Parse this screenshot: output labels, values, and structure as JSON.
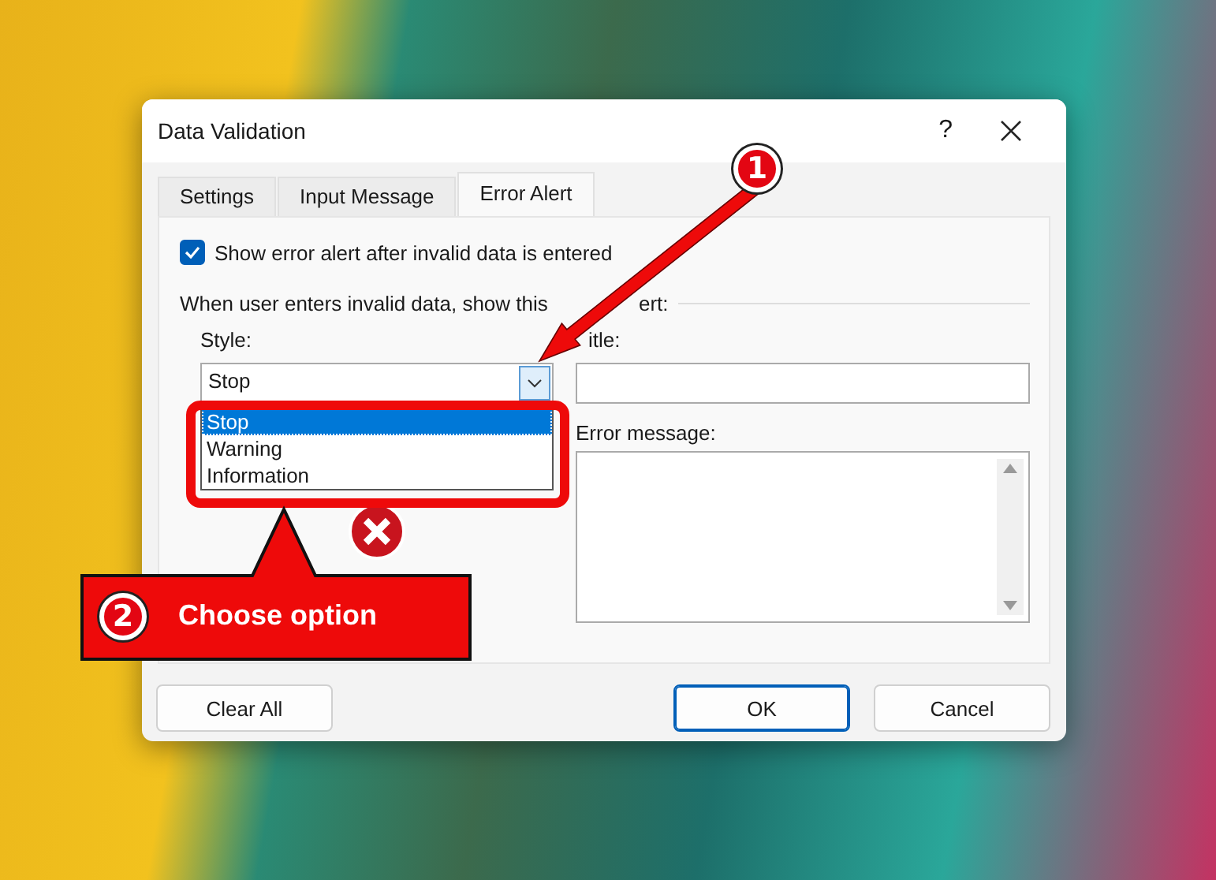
{
  "window": {
    "title": "Data Validation",
    "help": "?"
  },
  "tabs": [
    {
      "label": "Settings",
      "selected": false
    },
    {
      "label": "Input Message",
      "selected": false
    },
    {
      "label": "Error Alert",
      "selected": true
    }
  ],
  "show_alert": {
    "label": "Show error alert after invalid data is entered",
    "checked": true
  },
  "group_label": {
    "before": "When user enters invalid data, show this",
    "after": "ert:"
  },
  "style": {
    "label": "Style:",
    "value": "Stop",
    "expanded": true,
    "options": [
      {
        "label": "Stop",
        "selected": true
      },
      {
        "label": "Warning",
        "selected": false
      },
      {
        "label": "Information",
        "selected": false
      }
    ]
  },
  "title_field": {
    "label": "itle:"
  },
  "error_message": {
    "label": "Error message:"
  },
  "buttons": [
    {
      "label": "Clear All",
      "default": false
    },
    {
      "label": "OK",
      "default": true
    },
    {
      "label": "Cancel",
      "default": false
    }
  ],
  "annotations": [
    {
      "kind": "arrow",
      "number": "1"
    },
    {
      "kind": "callout",
      "number": "2",
      "text": "Choose option"
    }
  ]
}
